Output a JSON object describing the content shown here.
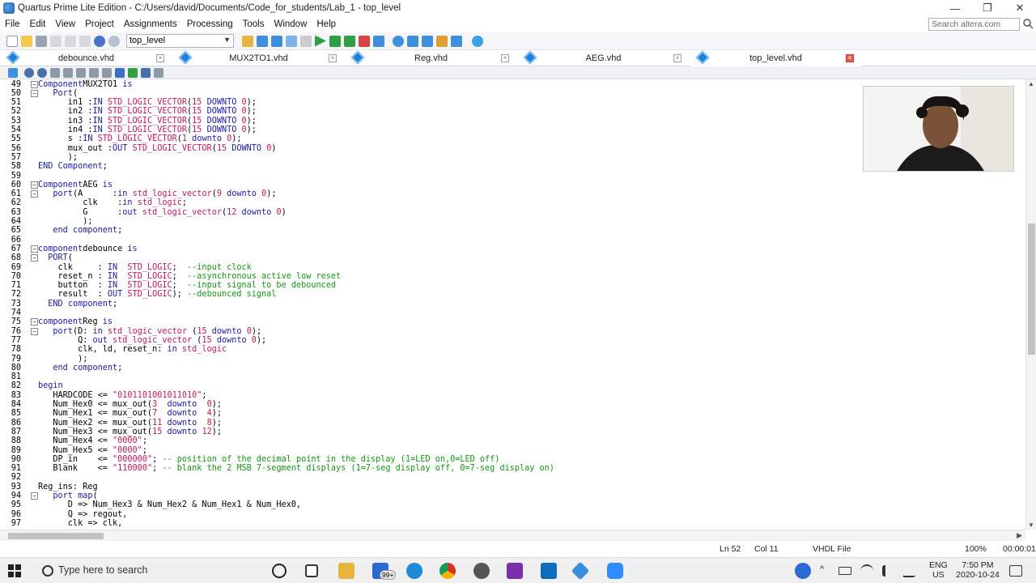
{
  "window": {
    "title": "Quartus Prime Lite Edition - C:/Users/david/Documents/Code_for_students/Lab_1 - top_level",
    "minimize": "—",
    "restore": "❐",
    "close": "✕"
  },
  "menu": [
    "File",
    "Edit",
    "View",
    "Project",
    "Assignments",
    "Processing",
    "Tools",
    "Window",
    "Help"
  ],
  "search": {
    "placeholder": "Search altera.com"
  },
  "toolbar": {
    "entity": "top_level"
  },
  "tabs": [
    {
      "label": "debounce.vhd",
      "active": false
    },
    {
      "label": "MUX2TO1.vhd",
      "active": false
    },
    {
      "label": "Reg.vhd",
      "active": false
    },
    {
      "label": "AEG.vhd",
      "active": false
    },
    {
      "label": "top_level.vhd",
      "active": true
    }
  ],
  "editor": {
    "lines": [
      {
        "n": "49",
        "fold": "⊟",
        "t": [
          [
            "kw",
            "Component"
          ],
          [
            "",
            "MUX2TO1 "
          ],
          [
            "kw",
            "is"
          ]
        ]
      },
      {
        "n": "50",
        "fold": "⊟",
        "t": [
          [
            "",
            "   "
          ],
          [
            "kw",
            "Port"
          ],
          [
            "",
            "("
          ]
        ]
      },
      {
        "n": "51",
        "t": [
          [
            "",
            "      in1 :"
          ],
          [
            "kw",
            "IN"
          ],
          [
            "",
            ""
          ],
          [
            "ty",
            " STD_LOGIC_VECTOR"
          ],
          [
            "",
            "("
          ],
          [
            "nm",
            "15"
          ],
          [
            "kw",
            " DOWNTO "
          ],
          [
            "nm",
            "0"
          ],
          [
            "",
            ");"
          ]
        ]
      },
      {
        "n": "52",
        "t": [
          [
            "",
            "      in2 :"
          ],
          [
            "kw",
            "IN"
          ],
          [
            "ty",
            " STD_LOGIC_VECTOR"
          ],
          [
            "",
            "("
          ],
          [
            "nm",
            "15"
          ],
          [
            "kw",
            " DOWNTO "
          ],
          [
            "nm",
            "0"
          ],
          [
            "",
            ");"
          ]
        ]
      },
      {
        "n": "53",
        "t": [
          [
            "",
            "      in3 :"
          ],
          [
            "kw",
            "IN"
          ],
          [
            "ty",
            " STD_LOGIC_VECTOR"
          ],
          [
            "",
            "("
          ],
          [
            "nm",
            "15"
          ],
          [
            "kw",
            " DOWNTO "
          ],
          [
            "nm",
            "0"
          ],
          [
            "",
            ");"
          ]
        ]
      },
      {
        "n": "54",
        "t": [
          [
            "",
            "      in4 :"
          ],
          [
            "kw",
            "IN"
          ],
          [
            "ty",
            " STD_LOGIC_VECTOR"
          ],
          [
            "",
            "("
          ],
          [
            "nm",
            "15"
          ],
          [
            "kw",
            " DOWNTO "
          ],
          [
            "nm",
            "0"
          ],
          [
            "",
            ");"
          ]
        ]
      },
      {
        "n": "55",
        "t": [
          [
            "",
            "      s :"
          ],
          [
            "kw",
            "IN"
          ],
          [
            "ty",
            " STD_LOGIC_VECTOR"
          ],
          [
            "",
            "("
          ],
          [
            "nm",
            "1"
          ],
          [
            "kw",
            " downto "
          ],
          [
            "nm",
            "0"
          ],
          [
            "",
            ");"
          ]
        ]
      },
      {
        "n": "56",
        "t": [
          [
            "",
            "      mux_out :"
          ],
          [
            "kw",
            "OUT"
          ],
          [
            "ty",
            " STD_LOGIC_VECTOR"
          ],
          [
            "",
            "("
          ],
          [
            "nm",
            "15"
          ],
          [
            "kw",
            " DOWNTO "
          ],
          [
            "nm",
            "0"
          ],
          [
            "",
            ")"
          ]
        ]
      },
      {
        "n": "57",
        "t": [
          [
            "",
            "      );"
          ]
        ]
      },
      {
        "n": "58",
        "t": [
          [
            "kw",
            "END Component"
          ],
          [
            "",
            ";"
          ]
        ]
      },
      {
        "n": "59",
        "t": [
          [
            "",
            ""
          ]
        ]
      },
      {
        "n": "60",
        "fold": "⊟",
        "t": [
          [
            "kw",
            "Component"
          ],
          [
            "",
            "AEG "
          ],
          [
            "kw",
            "is"
          ]
        ]
      },
      {
        "n": "61",
        "fold": "⊟",
        "t": [
          [
            "",
            "   "
          ],
          [
            "kw",
            "port"
          ],
          [
            "",
            ""
          ],
          [
            "",
            ""
          ],
          [
            "",
            "(A      :"
          ],
          [
            "kw",
            "in"
          ],
          [
            "ty",
            " std_logic_vector"
          ],
          [
            "",
            "("
          ],
          [
            "nm",
            "9"
          ],
          [
            "kw",
            " downto "
          ],
          [
            "nm",
            "0"
          ],
          [
            "",
            ");"
          ]
        ]
      },
      {
        "n": "62",
        "t": [
          [
            "",
            "         clk    :"
          ],
          [
            "kw",
            "in"
          ],
          [
            "ty",
            " std_logic"
          ],
          [
            "",
            ";"
          ]
        ]
      },
      {
        "n": "63",
        "t": [
          [
            "",
            "         G      :"
          ],
          [
            "kw",
            "out"
          ],
          [
            "ty",
            " std_logic_vector"
          ],
          [
            "",
            "("
          ],
          [
            "nm",
            "12"
          ],
          [
            "kw",
            " downto "
          ],
          [
            "nm",
            "0"
          ],
          [
            "",
            ")"
          ]
        ]
      },
      {
        "n": "64",
        "t": [
          [
            "",
            "         );"
          ]
        ]
      },
      {
        "n": "65",
        "t": [
          [
            "",
            "   "
          ],
          [
            "kw",
            "end component"
          ],
          [
            "",
            ";"
          ]
        ]
      },
      {
        "n": "66",
        "t": [
          [
            "",
            ""
          ]
        ]
      },
      {
        "n": "67",
        "fold": "⊟",
        "t": [
          [
            "kw",
            "component"
          ],
          [
            "",
            ""
          ],
          [
            "",
            ""
          ],
          [
            "",
            "debounce "
          ],
          [
            "kw",
            "is"
          ]
        ]
      },
      {
        "n": "68",
        "fold": "⊟",
        "t": [
          [
            "",
            "  "
          ],
          [
            "kw",
            "PORT"
          ],
          [
            "",
            "("
          ]
        ]
      },
      {
        "n": "69",
        "t": [
          [
            "",
            "    clk     : "
          ],
          [
            "kw",
            "IN"
          ],
          [
            "ty",
            "  STD_LOGIC"
          ],
          [
            "",
            ";  "
          ],
          [
            "cm",
            "--input clock"
          ]
        ]
      },
      {
        "n": "70",
        "t": [
          [
            "",
            "    reset_n : "
          ],
          [
            "kw",
            "IN"
          ],
          [
            "ty",
            "  STD_LOGIC"
          ],
          [
            "",
            ";  "
          ],
          [
            "cm",
            "--asynchronous active low reset"
          ]
        ]
      },
      {
        "n": "71",
        "t": [
          [
            "",
            "    button  : "
          ],
          [
            "kw",
            "IN"
          ],
          [
            "ty",
            "  STD_LOGIC"
          ],
          [
            "",
            ";  "
          ],
          [
            "cm",
            "--input signal to be debounced"
          ]
        ]
      },
      {
        "n": "72",
        "t": [
          [
            "",
            "    result  : "
          ],
          [
            "kw",
            "OUT"
          ],
          [
            "ty",
            " STD_LOGIC"
          ],
          [
            "",
            "); "
          ],
          [
            "cm",
            "--debounced signal"
          ]
        ]
      },
      {
        "n": "73",
        "t": [
          [
            "",
            "  "
          ],
          [
            "kw",
            "END component"
          ],
          [
            "",
            ";"
          ]
        ]
      },
      {
        "n": "74",
        "t": [
          [
            "",
            ""
          ]
        ]
      },
      {
        "n": "75",
        "fold": "⊟",
        "t": [
          [
            "kw",
            "component"
          ],
          [
            "",
            ""
          ],
          [
            "",
            "Reg "
          ],
          [
            "kw",
            "is"
          ]
        ]
      },
      {
        "n": "76",
        "fold": "⊟",
        "t": [
          [
            "",
            "   "
          ],
          [
            "kw",
            "port"
          ],
          [
            "",
            "(D: "
          ],
          [
            "kw",
            "in"
          ],
          [
            "ty",
            " std_logic_vector "
          ],
          [
            "",
            "("
          ],
          [
            "nm",
            "15"
          ],
          [
            "kw",
            " downto "
          ],
          [
            "nm",
            "0"
          ],
          [
            "",
            ");"
          ]
        ]
      },
      {
        "n": "77",
        "t": [
          [
            "",
            "        Q: "
          ],
          [
            "kw",
            "out"
          ],
          [
            "ty",
            " std_logic_vector "
          ],
          [
            "",
            "("
          ],
          [
            "nm",
            "15"
          ],
          [
            "kw",
            " downto "
          ],
          [
            "nm",
            "0"
          ],
          [
            "",
            ");"
          ]
        ]
      },
      {
        "n": "78",
        "t": [
          [
            "",
            "        clk, ld, reset_n: "
          ],
          [
            "kw",
            "in"
          ],
          [
            "ty",
            " std_logic"
          ]
        ]
      },
      {
        "n": "79",
        "t": [
          [
            "",
            "        );"
          ]
        ]
      },
      {
        "n": "80",
        "t": [
          [
            "",
            "   "
          ],
          [
            "kw",
            "end component"
          ],
          [
            "",
            ";"
          ]
        ]
      },
      {
        "n": "81",
        "t": [
          [
            "",
            ""
          ]
        ]
      },
      {
        "n": "82",
        "t": [
          [
            "kw",
            "begin"
          ]
        ]
      },
      {
        "n": "83",
        "t": [
          [
            "",
            "   HARDCODE <= "
          ],
          [
            "st",
            "\"0101101001011010\""
          ],
          [
            "",
            ";"
          ]
        ]
      },
      {
        "n": "84",
        "t": [
          [
            "",
            "   Num_Hex0 <= mux_out("
          ],
          [
            "nm",
            "3"
          ],
          [
            "kw",
            "  downto  "
          ],
          [
            "nm",
            "0"
          ],
          [
            "",
            ");"
          ]
        ]
      },
      {
        "n": "85",
        "t": [
          [
            "",
            "   Num_Hex1 <= mux_out("
          ],
          [
            "nm",
            "7"
          ],
          [
            "kw",
            "  downto  "
          ],
          [
            "nm",
            "4"
          ],
          [
            "",
            ");"
          ]
        ]
      },
      {
        "n": "86",
        "t": [
          [
            "",
            "   Num_Hex2 <= mux_out("
          ],
          [
            "nm",
            "11"
          ],
          [
            "kw",
            " downto  "
          ],
          [
            "nm",
            "8"
          ],
          [
            "",
            ");"
          ]
        ]
      },
      {
        "n": "87",
        "t": [
          [
            "",
            "   Num_Hex3 <= mux_out("
          ],
          [
            "nm",
            "15"
          ],
          [
            "kw",
            " downto "
          ],
          [
            "nm",
            "12"
          ],
          [
            "",
            ");"
          ]
        ]
      },
      {
        "n": "88",
        "t": [
          [
            "",
            "   Num_Hex4 <= "
          ],
          [
            "st",
            "\"0000\""
          ],
          [
            "",
            ";"
          ]
        ]
      },
      {
        "n": "89",
        "t": [
          [
            "",
            "   Num_Hex5 <= "
          ],
          [
            "st",
            "\"0000\""
          ],
          [
            "",
            ";"
          ]
        ]
      },
      {
        "n": "90",
        "t": [
          [
            "",
            "   DP_in    <= "
          ],
          [
            "st",
            "\"000000\""
          ],
          [
            "",
            "; "
          ],
          [
            "cm",
            "-- position of the decimal point in the display (1=LED on,0=LED off)"
          ]
        ]
      },
      {
        "n": "91",
        "t": [
          [
            "",
            "   Blank    <= "
          ],
          [
            "st",
            "\"110000\""
          ],
          [
            "",
            "; "
          ],
          [
            "cm",
            "-- blank the 2 MSB 7-segment displays (1=7-seg display off, 0=7-seg display on)"
          ]
        ]
      },
      {
        "n": "92",
        "t": [
          [
            "",
            ""
          ]
        ]
      },
      {
        "n": "93",
        "t": [
          [
            "",
            "Reg_ins: Reg"
          ]
        ]
      },
      {
        "n": "94",
        "fold": "⊟",
        "t": [
          [
            "",
            "   "
          ],
          [
            "kw",
            "port map"
          ],
          [
            "",
            "("
          ]
        ]
      },
      {
        "n": "95",
        "t": [
          [
            "",
            "      D => Num_Hex3 & Num_Hex2 & Num_Hex1 & Num_Hex0,"
          ]
        ]
      },
      {
        "n": "96",
        "t": [
          [
            "",
            "      Q => regout,"
          ]
        ]
      },
      {
        "n": "97",
        "t": [
          [
            "",
            "      clk => clk,"
          ]
        ]
      }
    ]
  },
  "status": {
    "line": "Ln 52",
    "col": "Col 11",
    "filetype": "VHDL File",
    "zoom": "100%",
    "time": "00:00:01"
  },
  "taskbar": {
    "search_placeholder": "Type here to search",
    "badge": "99+",
    "lang_top": "ENG",
    "lang_bottom": "US",
    "clock_time": "7:50 PM",
    "clock_date": "2020-10-24"
  }
}
